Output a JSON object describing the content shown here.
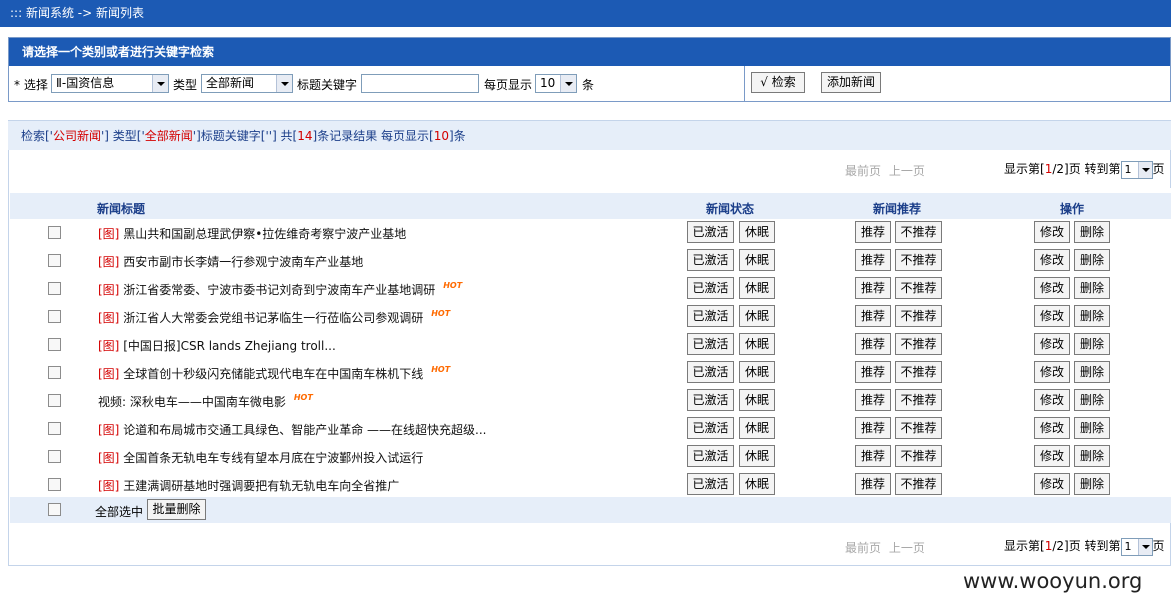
{
  "breadcrumb": "::: 新闻系统 -> 新闻列表",
  "search": {
    "heading": "请选择一个类别或者进行关键字检索",
    "select_label": "* 选择",
    "category_value": "Ⅱ-国资信息",
    "type_label": "类型",
    "type_value": "全部新闻",
    "keyword_label": "标题关键字",
    "keyword_value": "",
    "per_page_label": "每页显示",
    "per_page_value": "10",
    "per_page_unit": "条",
    "search_button": "√ 检索",
    "add_button": "添加新闻"
  },
  "result_info": {
    "p1": "检索['",
    "category": "公司新闻",
    "p2": "'] 类型['",
    "type": "全部新闻",
    "p3": "']标题关键字['",
    "keyword": "",
    "p4": "'] 共[",
    "total": "14",
    "p5": "]条记录结果 每页显示[",
    "per_page": "10",
    "p6": "]条"
  },
  "pager": {
    "first": "最前页",
    "prev": "上一页",
    "show_prefix": "显示第[",
    "current": "1",
    "sep": "/",
    "pages": "2",
    "show_suffix": "]页 转到第",
    "goto_value": "1",
    "goto_suffix": "页"
  },
  "columns": {
    "title": "新闻标题",
    "status": "新闻状态",
    "recommend": "新闻推荐",
    "actions": "操作"
  },
  "button_labels": {
    "activated": "已激活",
    "sleep": "休眠",
    "recommend": "推荐",
    "not_recommend": "不推荐",
    "edit": "修改",
    "delete": "删除"
  },
  "rows": [
    {
      "tag": "[图]",
      "title": "黑山共和国副总理武伊察•拉佐维奇考察宁波产业基地",
      "hot": ""
    },
    {
      "tag": "[图]",
      "title": "西安市副市长李婧一行参观宁波南车产业基地",
      "hot": ""
    },
    {
      "tag": "[图]",
      "title": "浙江省委常委、宁波市委书记刘奇到宁波南车产业基地调研",
      "hot": "HOT"
    },
    {
      "tag": "[图]",
      "title": "浙江省人大常委会党组书记茅临生一行莅临公司参观调研",
      "hot": "HOT"
    },
    {
      "tag": "[图]",
      "title": "[中国日报]CSR lands Zhejiang troll...",
      "hot": ""
    },
    {
      "tag": "[图]",
      "title": "全球首创十秒级闪充储能式现代电车在中国南车株机下线",
      "hot": "HOT"
    },
    {
      "tag": "",
      "title": "视频: 深秋电车——中国南车微电影",
      "hot": "HOT"
    },
    {
      "tag": "[图]",
      "title": "论道和布局城市交通工具绿色、智能产业革命 ——在线超快充超级...",
      "hot": ""
    },
    {
      "tag": "[图]",
      "title": "全国首条无轨电车专线有望本月底在宁波鄞州投入试运行",
      "hot": ""
    },
    {
      "tag": "[图]",
      "title": "王建满调研基地时强调要把有轨无轨电车向全省推广",
      "hot": ""
    }
  ],
  "select_all_label": "全部选中",
  "batch_delete_button": "批量删除",
  "watermark": "www.wooyun.org"
}
